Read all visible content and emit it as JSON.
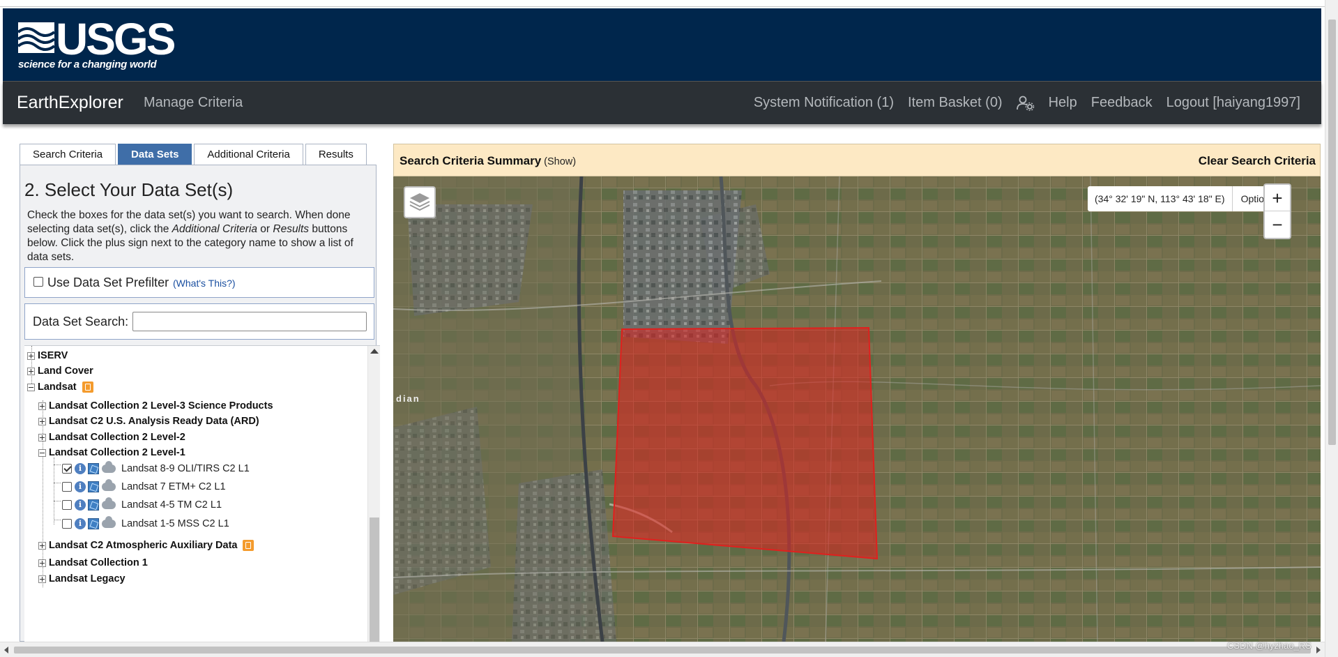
{
  "header": {
    "logo_word": "USGS",
    "logo_tagline": "science for a changing world",
    "brand_color": "#00264c"
  },
  "nav": {
    "app_name": "EarthExplorer",
    "manage": "Manage Criteria",
    "right_items": [
      "System Notification (1)",
      "Item Basket (0)",
      "Help",
      "Feedback",
      "Logout [haiyang1997]"
    ],
    "user_icon": "user-gear-icon"
  },
  "tabs": {
    "items": [
      "Search Criteria",
      "Data Sets",
      "Additional Criteria",
      "Results"
    ],
    "active": "Data Sets",
    "active_color": "#3f6ea8"
  },
  "panel": {
    "heading": "2. Select Your Data Set(s)",
    "instr_1": "Check the boxes for the data set(s) you want to search. When done selecting data set(s), click the ",
    "instr_em1": "Additional Criteria",
    "instr_2": " or ",
    "instr_em2": "Results",
    "instr_3": " buttons below. Click the plus sign next to the category name to show a list of data sets.",
    "prefilter_label": "Use Data Set Prefilter",
    "prefilter_help": "(What's This?)",
    "search_label": "Data Set Search:",
    "search_value": ""
  },
  "tree": {
    "root": [
      {
        "label": "ISERV",
        "expanded": false
      },
      {
        "label": "Land Cover",
        "expanded": false
      },
      {
        "label": "Landsat",
        "expanded": true
      }
    ],
    "landsat_children": [
      "Landsat Collection 2 Level-3 Science Products",
      "Landsat C2 U.S. Analysis Ready Data (ARD)",
      "Landsat Collection 2 Level-2",
      "Landsat Collection 2 Level-1"
    ],
    "level1_datasets": [
      {
        "label": "Landsat 8-9 OLI/TIRS C2 L1",
        "checked": true
      },
      {
        "label": "Landsat 7 ETM+ C2 L1",
        "checked": false
      },
      {
        "label": "Landsat 4-5 TM C2 L1",
        "checked": false
      },
      {
        "label": "Landsat 1-5 MSS C2 L1",
        "checked": false
      }
    ],
    "landsat_more": [
      "Landsat C2 Atmospheric Auxiliary Data",
      "Landsat Collection 1",
      "Landsat Legacy"
    ]
  },
  "summary": {
    "title": "Search Criteria Summary",
    "show": "(Show)",
    "clear": "Clear Search Criteria",
    "bg_color": "#fde9c4"
  },
  "map": {
    "coords": "(34° 32' 19\" N, 113° 43' 18\" E)",
    "options": "Options",
    "zoom_in": "+",
    "zoom_out": "−",
    "place_label": "dian",
    "aoi_color": "#e0201e",
    "layers_icon": "layers-icon"
  },
  "watermark": "CSDN @hyzhao_RS"
}
